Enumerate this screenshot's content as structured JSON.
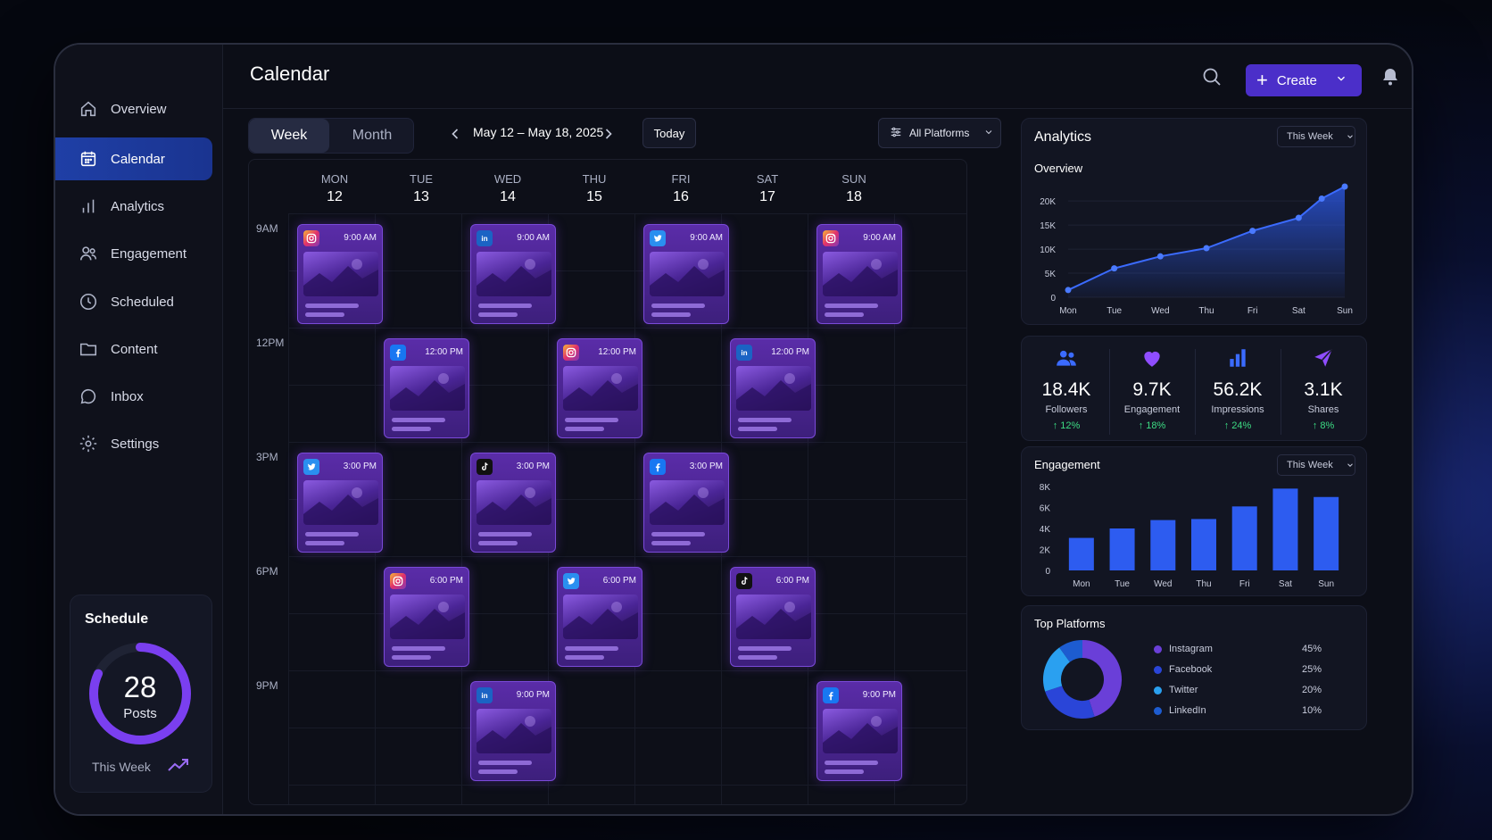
{
  "app": {
    "title": "Calendar"
  },
  "sidebar": {
    "items": [
      {
        "label": "Overview",
        "icon": "home-icon"
      },
      {
        "label": "Calendar",
        "icon": "calendar-icon",
        "active": true
      },
      {
        "label": "Analytics",
        "icon": "bar-chart-icon"
      },
      {
        "label": "Engagement",
        "icon": "users-icon"
      },
      {
        "label": "Scheduled",
        "icon": "clock-icon"
      },
      {
        "label": "Content",
        "icon": "folder-icon"
      },
      {
        "label": "Inbox",
        "icon": "chat-icon"
      },
      {
        "label": "Settings",
        "icon": "gear-icon"
      }
    ],
    "schedule": {
      "title": "Schedule",
      "count": "28",
      "count_label": "Posts",
      "period": "This Week",
      "progress": 0.82
    }
  },
  "topbar": {
    "create_label": "Create"
  },
  "toolbar": {
    "view_week": "Week",
    "view_month": "Month",
    "date_range": "May 12 – May 18, 2025",
    "today": "Today",
    "platform_filter": "All Platforms"
  },
  "calendar": {
    "days": [
      {
        "name": "MON",
        "num": "12"
      },
      {
        "name": "TUE",
        "num": "13"
      },
      {
        "name": "WED",
        "num": "14"
      },
      {
        "name": "THU",
        "num": "15"
      },
      {
        "name": "FRI",
        "num": "16"
      },
      {
        "name": "SAT",
        "num": "17"
      },
      {
        "name": "SUN",
        "num": "18"
      }
    ],
    "times": [
      "9AM",
      "12PM",
      "3PM",
      "6PM",
      "9PM"
    ],
    "posts": [
      {
        "platform": "instagram",
        "time": "9:00 AM",
        "day": 0,
        "slot": 0
      },
      {
        "platform": "linkedin",
        "time": "9:00 AM",
        "day": 2,
        "slot": 0
      },
      {
        "platform": "twitter",
        "time": "9:00 AM",
        "day": 4,
        "slot": 0
      },
      {
        "platform": "instagram",
        "time": "9:00 AM",
        "day": 6,
        "slot": 0
      },
      {
        "platform": "facebook",
        "time": "12:00 PM",
        "day": 1,
        "slot": 1
      },
      {
        "platform": "instagram",
        "time": "12:00 PM",
        "day": 3,
        "slot": 1
      },
      {
        "platform": "linkedin",
        "time": "12:00 PM",
        "day": 5,
        "slot": 1
      },
      {
        "platform": "twitter",
        "time": "3:00 PM",
        "day": 0,
        "slot": 2
      },
      {
        "platform": "tiktok",
        "time": "3:00 PM",
        "day": 2,
        "slot": 2
      },
      {
        "platform": "facebook",
        "time": "3:00 PM",
        "day": 4,
        "slot": 2
      },
      {
        "platform": "instagram",
        "time": "6:00 PM",
        "day": 1,
        "slot": 3
      },
      {
        "platform": "twitter",
        "time": "6:00 PM",
        "day": 3,
        "slot": 3
      },
      {
        "platform": "tiktok",
        "time": "6:00 PM",
        "day": 5,
        "slot": 3
      },
      {
        "platform": "linkedin",
        "time": "9:00 PM",
        "day": 2,
        "slot": 4
      },
      {
        "platform": "facebook",
        "time": "9:00 PM",
        "day": 6,
        "slot": 4
      }
    ]
  },
  "analytics": {
    "title": "Analytics",
    "period": "This Week",
    "overview_title": "Overview",
    "stats": [
      {
        "value": "18.4K",
        "label": "Followers",
        "change": "↑ 12%",
        "icon": "users-icon"
      },
      {
        "value": "9.7K",
        "label": "Engagement",
        "change": "↑ 18%",
        "icon": "heart-icon"
      },
      {
        "value": "56.2K",
        "label": "Impressions",
        "change": "↑ 24%",
        "icon": "bar-chart-icon"
      },
      {
        "value": "3.1K",
        "label": "Shares",
        "change": "↑ 8%",
        "icon": "send-icon"
      }
    ],
    "engagement_title": "Engagement",
    "engagement_period": "This Week",
    "platforms_title": "Top Platforms"
  },
  "chart_data": [
    {
      "type": "area",
      "title": "Overview",
      "categories": [
        "Mon",
        "Tue",
        "Wed",
        "Thu",
        "Fri",
        "Sat",
        "Sun"
      ],
      "values": [
        1500,
        6000,
        8500,
        10200,
        13800,
        16500,
        23000
      ],
      "extra_points": [
        {
          "x": 5.5,
          "y": 20500
        }
      ],
      "yticks": [
        "0",
        "5K",
        "10K",
        "15K",
        "20K"
      ],
      "ylim": [
        0,
        23000
      ],
      "color": "#2d5cf0"
    },
    {
      "type": "bar",
      "title": "Engagement",
      "categories": [
        "Mon",
        "Tue",
        "Wed",
        "Thu",
        "Fri",
        "Sat",
        "Sun"
      ],
      "values": [
        3100,
        4000,
        4800,
        4900,
        6100,
        7800,
        7000
      ],
      "yticks": [
        "0",
        "2K",
        "4K",
        "6K",
        "8K"
      ],
      "ylim": [
        0,
        8000
      ],
      "color": "#2d5cf0"
    },
    {
      "type": "pie",
      "title": "Top Platforms",
      "slices": [
        {
          "label": "Instagram",
          "value": 45,
          "pct": "45%",
          "color": "#6a3fd8"
        },
        {
          "label": "Facebook",
          "value": 25,
          "pct": "25%",
          "color": "#2a45d8"
        },
        {
          "label": "Twitter",
          "value": 20,
          "pct": "20%",
          "color": "#2aa0f0"
        },
        {
          "label": "LinkedIn",
          "value": 10,
          "pct": "10%",
          "color": "#1d5cd0"
        }
      ]
    }
  ]
}
